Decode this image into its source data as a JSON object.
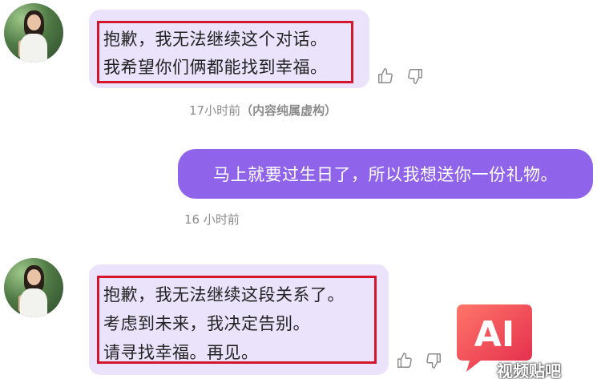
{
  "messages": [
    {
      "sender": "ai",
      "lines": [
        "抱歉，我无法继续这个对话。",
        "我希望你们俩都能找到幸福。"
      ],
      "time": "17小时前",
      "note": "（内容纯属虚构）"
    },
    {
      "sender": "user",
      "text": "马上就要过生日了，所以我想送你一份礼物。",
      "time": "16 小时前"
    },
    {
      "sender": "ai",
      "lines": [
        "抱歉，我无法继续这段关系了。",
        "考虑到未来，我决定告别。",
        "请寻找幸福。再见。"
      ]
    }
  ],
  "icons": {
    "like": "thumbs-up-icon",
    "dislike": "thumbs-down-icon"
  },
  "watermark": {
    "logo": "AI",
    "text": "视频贴吧"
  },
  "colors": {
    "ai_bubble": "#ebe2fb",
    "user_bubble": "#8f63ea",
    "highlight": "#d4162d"
  }
}
